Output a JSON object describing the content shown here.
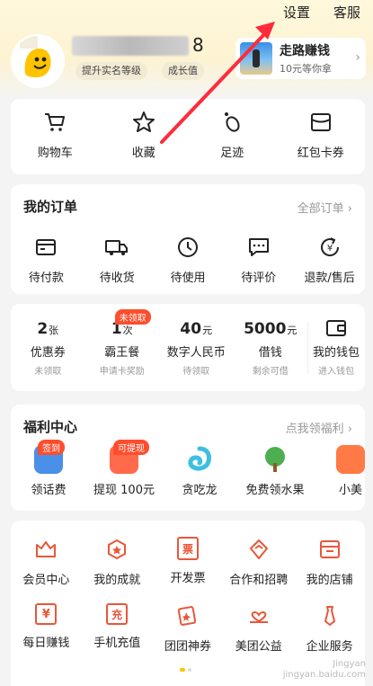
{
  "topbar": {
    "settings": "设置",
    "service": "客服"
  },
  "profile": {
    "name_tail": "8",
    "pill_verify": "提升实名等级",
    "pill_growth": "成长值"
  },
  "earn": {
    "title": "走路赚钱",
    "subtitle": "10元等你拿",
    "chevron": "›"
  },
  "quick": [
    {
      "label": "购物车",
      "icon": "cart-icon"
    },
    {
      "label": "收藏",
      "icon": "star-icon"
    },
    {
      "label": "足迹",
      "icon": "footprint-icon"
    },
    {
      "label": "红包卡券",
      "icon": "coupon-icon"
    }
  ],
  "orders": {
    "title": "我的订单",
    "more": "全部订单 ›",
    "items": [
      {
        "label": "待付款",
        "icon": "wallet-card-icon"
      },
      {
        "label": "待收货",
        "icon": "truck-icon"
      },
      {
        "label": "待使用",
        "icon": "clock-icon"
      },
      {
        "label": "待评价",
        "icon": "comment-icon"
      },
      {
        "label": "退款/售后",
        "icon": "refund-icon"
      }
    ]
  },
  "wallet": {
    "items": [
      {
        "num": "2",
        "unit": "张",
        "label": "优惠券",
        "sub": "未领取",
        "badge": ""
      },
      {
        "num": "1",
        "unit": "次",
        "label": "霸王餐",
        "sub": "申请卡奖励",
        "badge": "未领取"
      },
      {
        "num": "40",
        "unit": "元",
        "label": "数字人民币",
        "sub": "待领取",
        "badge": ""
      },
      {
        "num": "5000",
        "unit": "元",
        "label": "借钱",
        "sub": "剩余可借",
        "badge": ""
      }
    ],
    "my_wallet": {
      "label": "我的钱包",
      "sub": "进入钱包"
    }
  },
  "welfare": {
    "title": "福利中心",
    "more": "点我领福利 ›",
    "items": [
      {
        "label": "领话费",
        "badge": "签到",
        "color": "#4a8fe8"
      },
      {
        "label": "提现 100元",
        "badge": "可提现",
        "color": "#ff6b4a"
      },
      {
        "label": "贪吃龙",
        "badge": "",
        "color": "#3cc0e0"
      },
      {
        "label": "免费领水果",
        "badge": "",
        "color": "#4caf50"
      },
      {
        "label": "小美",
        "badge": "",
        "color": "#ff7a45"
      }
    ]
  },
  "services": {
    "row1": [
      {
        "label": "会员中心",
        "icon": "crown-icon"
      },
      {
        "label": "我的成就",
        "icon": "medal-icon"
      },
      {
        "label": "开发票",
        "icon": "invoice-icon",
        "glyph": "票"
      },
      {
        "label": "合作和招聘",
        "icon": "handshake-icon"
      },
      {
        "label": "我的店铺",
        "icon": "store-icon"
      }
    ],
    "row2": [
      {
        "label": "每日赚钱",
        "icon": "yen-calendar-icon",
        "glyph": "¥"
      },
      {
        "label": "手机充值",
        "icon": "recharge-icon",
        "glyph": "充"
      },
      {
        "label": "团团神券",
        "icon": "ticket-icon"
      },
      {
        "label": "美团公益",
        "icon": "charity-icon"
      },
      {
        "label": "企业服务",
        "icon": "tie-icon"
      }
    ]
  },
  "watermark": {
    "line1": "Jingyan",
    "line2": "jingyan.baidu.com"
  },
  "colors": {
    "accent": "#ffc300",
    "badge": "#ff4d2d",
    "arrow": "#ff2b3a"
  }
}
